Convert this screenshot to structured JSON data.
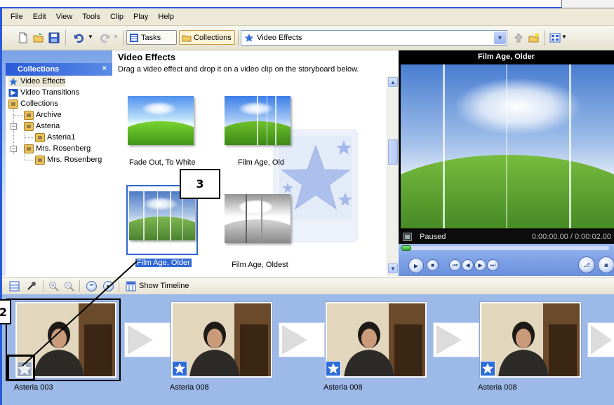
{
  "menu": [
    "File",
    "Edit",
    "View",
    "Tools",
    "Clip",
    "Play",
    "Help"
  ],
  "toolbar": {
    "tasks_label": "Tasks",
    "collections_label": "Collections",
    "combo_value": "Video Effects"
  },
  "collections_pane": {
    "header": "Collections",
    "close_glyph": "×",
    "tree": [
      {
        "label": "Video Effects",
        "icon": "star-icon",
        "selected": true
      },
      {
        "label": "Video Transitions",
        "icon": "transition-icon"
      },
      {
        "label": "Collections",
        "icon": "folder-icon"
      },
      {
        "label": "Archive",
        "icon": "folder-icon"
      },
      {
        "label": "Asteria",
        "icon": "folder-icon"
      },
      {
        "label": "Asteria1",
        "icon": "folder-icon"
      },
      {
        "label": "Mrs. Rosenberg",
        "icon": "folder-icon"
      },
      {
        "label": "Mrs. Rosenberg",
        "icon": "folder-icon"
      }
    ]
  },
  "effects_pane": {
    "title": "Video Effects",
    "subtitle": "Drag a video effect and drop it on a video clip on the storyboard below.",
    "items": [
      {
        "label": "Fade Out, To White"
      },
      {
        "label": "Film Age, Old"
      },
      {
        "label": "Film Age, Older",
        "selected": true
      },
      {
        "label": "Film Age, Oldest"
      }
    ]
  },
  "callouts": {
    "step3": "3",
    "step2": "2"
  },
  "preview": {
    "title": "Film Age, Older",
    "status": "Paused",
    "time": "0:00:00.00 / 0:00:02.00"
  },
  "storyboard_toolbar": {
    "show_timeline": "Show Timeline"
  },
  "storyboard": {
    "clips": [
      {
        "label": "Asteria 003",
        "selected": true
      },
      {
        "label": "Asteria 008"
      },
      {
        "label": "Asteria 008"
      },
      {
        "label": "Asteria 008"
      }
    ]
  },
  "colors": {
    "accent": "#3167d3",
    "storyboard_bg": "#9cb9e8",
    "titlebar": "#2a5bd7"
  }
}
